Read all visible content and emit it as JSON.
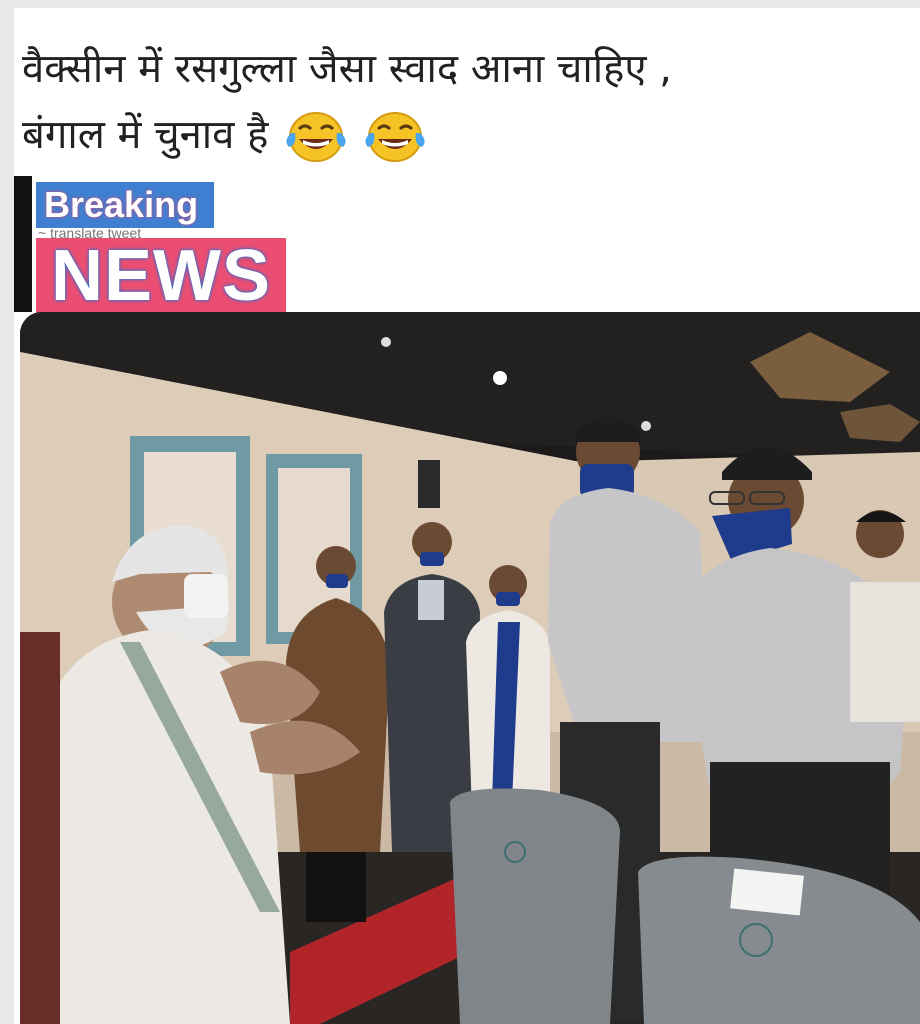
{
  "post": {
    "caption_line1": "वैक्सीन में रसगुल्ला जैसा स्वाद आना चाहिए ,",
    "caption_line2": "बंगाल में चुनाव है",
    "emojis": [
      "face-with-tears-of-joy-icon",
      "face-with-tears-of-joy-icon"
    ]
  },
  "sticker": {
    "breaking_label": "Breaking",
    "news_label": "NEWS",
    "ghost_text": "~ translate tweet"
  },
  "photo": {
    "description_alt": "",
    "colors": {
      "ceiling": "#1a1a1a",
      "wall": "#d8c7b3",
      "mirror_frame": "#6f9aa4",
      "seat": "#7f8588",
      "carpet": "#b0242a",
      "mask": "#1f3c8c"
    }
  }
}
